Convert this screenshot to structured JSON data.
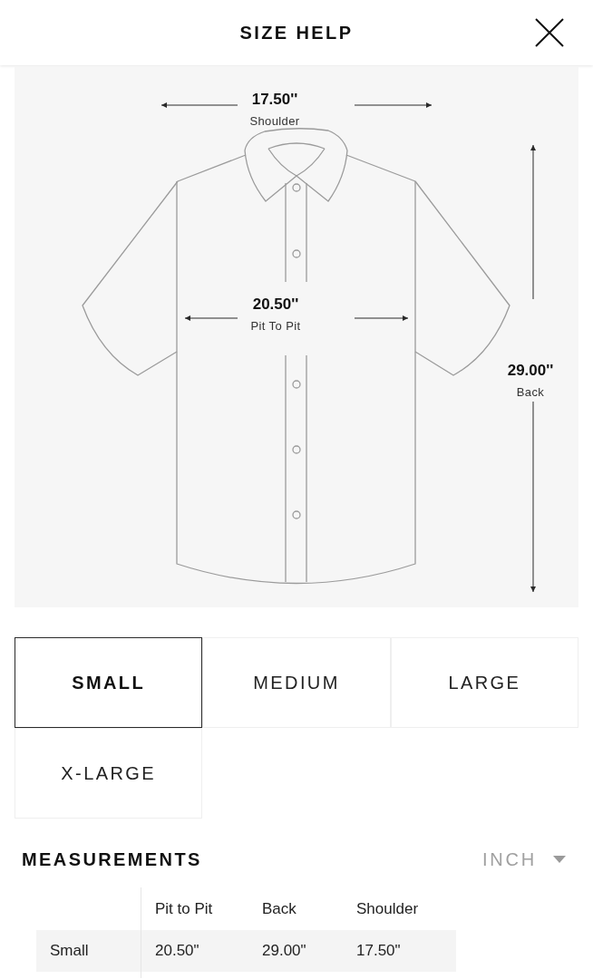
{
  "header": {
    "title": "SIZE HELP"
  },
  "diagram": {
    "measurements": [
      {
        "kind": "horizontal",
        "value": "17.50''",
        "label": "Shoulder"
      },
      {
        "kind": "horizontal",
        "value": "20.50''",
        "label": "Pit To Pit"
      },
      {
        "kind": "vertical",
        "value": "29.00''",
        "label": "Back"
      }
    ]
  },
  "sizes": [
    {
      "label": "SMALL",
      "selected": true
    },
    {
      "label": "MEDIUM",
      "selected": false
    },
    {
      "label": "LARGE",
      "selected": false
    },
    {
      "label": "X-LARGE",
      "selected": false
    }
  ],
  "measurements": {
    "title": "MEASUREMENTS",
    "unit": "INCH",
    "columns": [
      "Pit to Pit",
      "Back",
      "Shoulder"
    ],
    "rows": [
      {
        "size": "Small",
        "values": [
          "20.50\"",
          "29.00\"",
          "17.50\""
        ]
      }
    ]
  }
}
